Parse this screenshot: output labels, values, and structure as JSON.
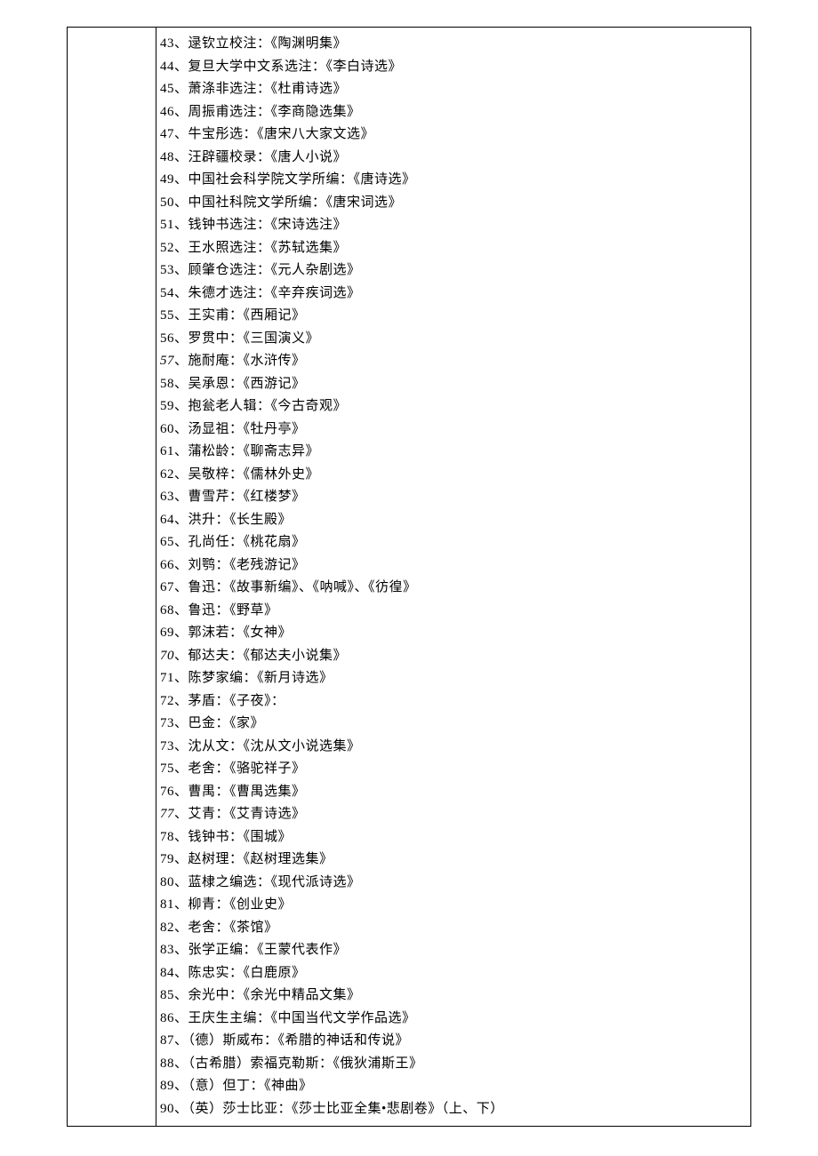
{
  "entries": [
    {
      "num": "43",
      "italic": false,
      "text": "、逯钦立校注：《陶渊明集》"
    },
    {
      "num": "44",
      "italic": false,
      "text": "、复旦大学中文系选注：《李白诗选》"
    },
    {
      "num": "45",
      "italic": false,
      "text": "、萧涤非选注：《杜甫诗选》"
    },
    {
      "num": "46",
      "italic": false,
      "text": "、周振甫选注：《李商隐选集》"
    },
    {
      "num": "47",
      "italic": false,
      "text": "、牛宝彤选：《唐宋八大家文选》"
    },
    {
      "num": "48",
      "italic": false,
      "text": "、汪辟疆校录：《唐人小说》"
    },
    {
      "num": "49",
      "italic": false,
      "text": "、中国社会科学院文学所编：《唐诗选》"
    },
    {
      "num": "50",
      "italic": false,
      "text": "、中国社科院文学所编：《唐宋词选》"
    },
    {
      "num": "51",
      "italic": false,
      "text": "、钱钟书选注：《宋诗选注》"
    },
    {
      "num": "52",
      "italic": false,
      "text": "、王水照选注：《苏轼选集》"
    },
    {
      "num": "53",
      "italic": false,
      "text": "、顾肇仓选注：《元人杂剧选》"
    },
    {
      "num": "54",
      "italic": false,
      "text": "、朱德才选注：《辛弃疾词选》"
    },
    {
      "num": "55",
      "italic": false,
      "text": "、王实甫：《西厢记》"
    },
    {
      "num": "56",
      "italic": false,
      "text": "、罗贯中：《三国演义》"
    },
    {
      "num": "57",
      "italic": true,
      "text": "、施耐庵：《水浒传》"
    },
    {
      "num": "58",
      "italic": false,
      "text": "、吴承恩：《西游记》"
    },
    {
      "num": "59",
      "italic": false,
      "text": "、抱瓮老人辑：《今古奇观》"
    },
    {
      "num": "60",
      "italic": false,
      "text": "、汤显祖：《牡丹亭》"
    },
    {
      "num": "61",
      "italic": false,
      "text": "、蒲松龄：《聊斋志异》"
    },
    {
      "num": "62",
      "italic": false,
      "text": "、吴敬梓：《儒林外史》"
    },
    {
      "num": "63",
      "italic": false,
      "text": "、曹雪芹：《红楼梦》"
    },
    {
      "num": "64",
      "italic": false,
      "text": "、洪升：《长生殿》"
    },
    {
      "num": "65",
      "italic": false,
      "text": "、孔尚任：《桃花扇》"
    },
    {
      "num": "66",
      "italic": false,
      "text": "、刘鹗：《老残游记》"
    },
    {
      "num": "67",
      "italic": false,
      "text": "、鲁迅：《故事新编》、《呐喊》、《彷徨》"
    },
    {
      "num": "68",
      "italic": false,
      "text": "、鲁迅：《野草》"
    },
    {
      "num": "69",
      "italic": false,
      "text": "、郭沫若：《女神》"
    },
    {
      "num": "70",
      "italic": true,
      "text": "、郁达夫：《郁达夫小说集》"
    },
    {
      "num": "71",
      "italic": false,
      "text": "、陈梦家编：《新月诗选》"
    },
    {
      "num": "72",
      "italic": false,
      "text": "、茅盾：《子夜》："
    },
    {
      "num": "73",
      "italic": false,
      "text": "、巴金：《家》"
    },
    {
      "num": "73",
      "italic": false,
      "text": "、沈从文：《沈从文小说选集》"
    },
    {
      "num": "75",
      "italic": false,
      "text": "、老舍：《骆驼祥子》"
    },
    {
      "num": "76",
      "italic": false,
      "text": "、曹禺：《曹禺选集》"
    },
    {
      "num": "77",
      "italic": true,
      "text": "、艾青：《艾青诗选》"
    },
    {
      "num": "78",
      "italic": false,
      "text": "、钱钟书：《围城》"
    },
    {
      "num": "79",
      "italic": false,
      "text": "、赵树理：《赵树理选集》"
    },
    {
      "num": "80",
      "italic": false,
      "text": "、蓝棣之编选：《现代派诗选》"
    },
    {
      "num": "81",
      "italic": false,
      "text": "、柳青：《创业史》"
    },
    {
      "num": "82",
      "italic": false,
      "text": "、老舍：《茶馆》"
    },
    {
      "num": "83",
      "italic": false,
      "text": "、张学正编：《王蒙代表作》"
    },
    {
      "num": "84",
      "italic": false,
      "text": "、陈忠实：《白鹿原》"
    },
    {
      "num": "85",
      "italic": false,
      "text": "、余光中：《余光中精品文集》"
    },
    {
      "num": "86",
      "italic": false,
      "text": "、王庆生主编：《中国当代文学作品选》"
    },
    {
      "num": "87",
      "italic": false,
      "text": "、（德）斯威布：《希腊的神话和传说》"
    },
    {
      "num": "88",
      "italic": false,
      "text": "、（古希腊）索福克勒斯：《俄狄浦斯王》"
    },
    {
      "num": "89",
      "italic": false,
      "text": "、（意）但丁：《神曲》"
    },
    {
      "num": "90",
      "italic": false,
      "text": "、（英）莎士比亚：《莎士比亚全集•悲剧卷》（上、下）"
    }
  ]
}
